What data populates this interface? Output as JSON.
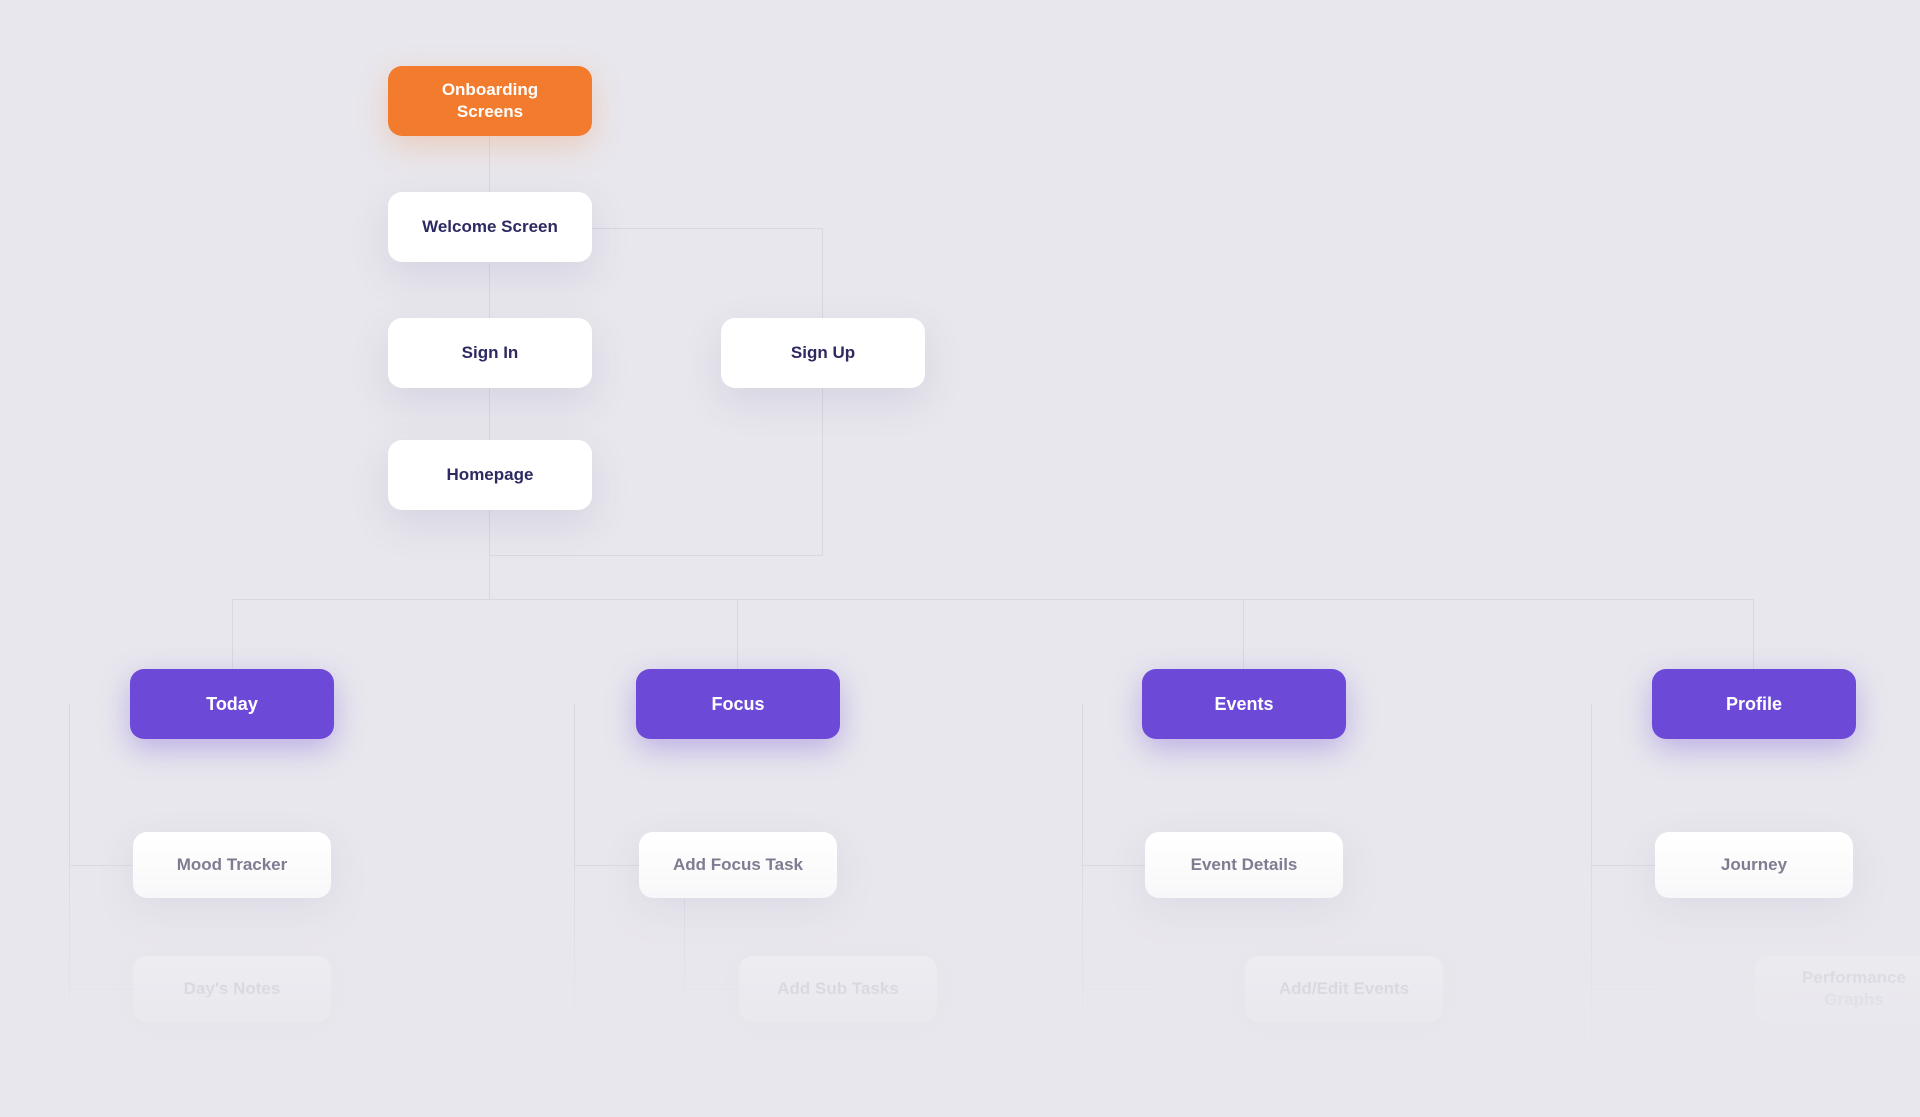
{
  "root": {
    "label": "Onboarding\nScreens"
  },
  "onboarding": {
    "welcome": "Welcome Screen",
    "sign_in": "Sign In",
    "sign_up": "Sign Up",
    "homepage": "Homepage"
  },
  "sections": {
    "today": {
      "label": "Today",
      "children": [
        "Mood Tracker",
        "Day's Notes"
      ]
    },
    "focus": {
      "label": "Focus",
      "children": [
        "Add Focus Task",
        "Add Sub Tasks"
      ]
    },
    "events": {
      "label": "Events",
      "children": [
        "Event Details",
        "Add/Edit Events"
      ]
    },
    "profile": {
      "label": "Profile",
      "children": [
        "Journey",
        "Performance\nGraphs"
      ]
    }
  },
  "colors": {
    "root": "#f27b2e",
    "section": "#6d49d8",
    "node_text": "#2d2a62",
    "child_text": "#6d6b82",
    "bg": "#e8e7ed"
  }
}
